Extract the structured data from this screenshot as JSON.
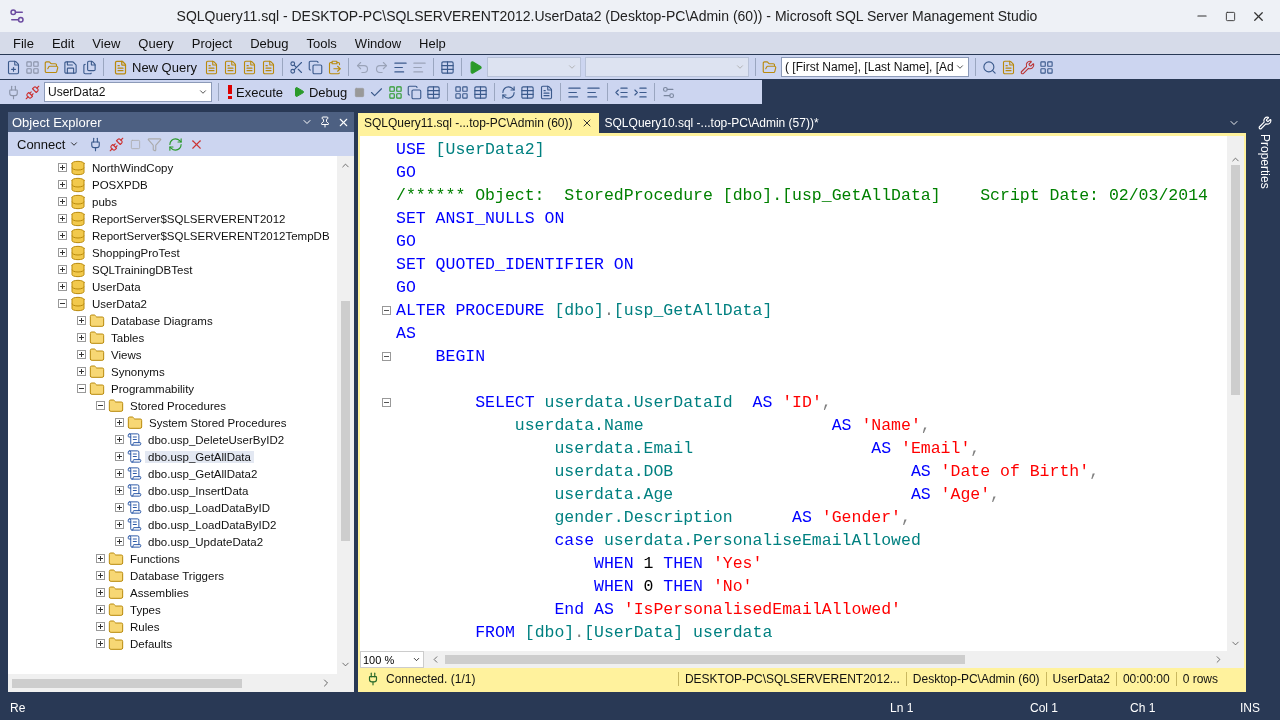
{
  "window": {
    "title": "SQLQuery11.sql - DESKTOP-PC\\SQLSERVERENT2012.UserData2 (Desktop-PC\\Admin (60)) - Microsoft SQL Server Management Studio"
  },
  "menu": [
    "File",
    "Edit",
    "View",
    "Query",
    "Project",
    "Debug",
    "Tools",
    "Window",
    "Help"
  ],
  "toolbar": {
    "new_query": "New Query",
    "database": "UserData2",
    "execute": "Execute",
    "debug": "Debug",
    "columns_combo": "( [First Name], [Last Name], [Ad"
  },
  "object_explorer": {
    "title": "Object Explorer",
    "connect": "Connect",
    "tree": [
      {
        "label": "NorthWindCopy",
        "kind": "db",
        "expanded": false,
        "selected": false
      },
      {
        "label": "POSXPDB",
        "kind": "db",
        "expanded": false,
        "selected": false
      },
      {
        "label": "pubs",
        "kind": "db",
        "expanded": false,
        "selected": false
      },
      {
        "label": "ReportServer$SQLSERVERENT2012",
        "kind": "db",
        "expanded": false,
        "selected": false
      },
      {
        "label": "ReportServer$SQLSERVERENT2012TempDB",
        "kind": "db",
        "expanded": false,
        "selected": false
      },
      {
        "label": "ShoppingProTest",
        "kind": "db",
        "expanded": false,
        "selected": false
      },
      {
        "label": "SQLTrainingDBTest",
        "kind": "db",
        "expanded": false,
        "selected": false
      },
      {
        "label": "UserData",
        "kind": "db",
        "expanded": false,
        "selected": false
      },
      {
        "label": "UserData2",
        "kind": "db",
        "expanded": true,
        "selected": false,
        "children": [
          {
            "label": "Database Diagrams",
            "kind": "folder",
            "expanded": false,
            "selected": false
          },
          {
            "label": "Tables",
            "kind": "folder",
            "expanded": false,
            "selected": false
          },
          {
            "label": "Views",
            "kind": "folder",
            "expanded": false,
            "selected": false
          },
          {
            "label": "Synonyms",
            "kind": "folder",
            "expanded": false,
            "selected": false
          },
          {
            "label": "Programmability",
            "kind": "folder",
            "expanded": true,
            "selected": false,
            "children": [
              {
                "label": "Stored Procedures",
                "kind": "folder",
                "expanded": true,
                "selected": false,
                "children": [
                  {
                    "label": "System Stored Procedures",
                    "kind": "folder",
                    "expanded": false,
                    "selected": false
                  },
                  {
                    "label": "dbo.usp_DeleteUserByID2",
                    "kind": "proc",
                    "expanded": false,
                    "selected": false
                  },
                  {
                    "label": "dbo.usp_GetAllData",
                    "kind": "proc",
                    "expanded": false,
                    "selected": true
                  },
                  {
                    "label": "dbo.usp_GetAllData2",
                    "kind": "proc",
                    "expanded": false,
                    "selected": false
                  },
                  {
                    "label": "dbo.usp_InsertData",
                    "kind": "proc",
                    "expanded": false,
                    "selected": false
                  },
                  {
                    "label": "dbo.usp_LoadDataByID",
                    "kind": "proc",
                    "expanded": false,
                    "selected": false
                  },
                  {
                    "label": "dbo.usp_LoadDataByID2",
                    "kind": "proc",
                    "expanded": false,
                    "selected": false
                  },
                  {
                    "label": "dbo.usp_UpdateData2",
                    "kind": "proc",
                    "expanded": false,
                    "selected": false
                  }
                ]
              },
              {
                "label": "Functions",
                "kind": "folder",
                "expanded": false,
                "selected": false
              },
              {
                "label": "Database Triggers",
                "kind": "folder",
                "expanded": false,
                "selected": false
              },
              {
                "label": "Assemblies",
                "kind": "folder",
                "expanded": false,
                "selected": false
              },
              {
                "label": "Types",
                "kind": "folder",
                "expanded": false,
                "selected": false
              },
              {
                "label": "Rules",
                "kind": "folder",
                "expanded": false,
                "selected": false
              },
              {
                "label": "Defaults",
                "kind": "folder",
                "expanded": false,
                "selected": false
              }
            ]
          }
        ]
      }
    ]
  },
  "editor": {
    "tabs": [
      {
        "label": "SQLQuery11.sql -...top-PC\\Admin (60))",
        "selected": true
      },
      {
        "label": "SQLQuery10.sql -...top-PC\\Admin (57))*",
        "selected": false
      }
    ],
    "lines": [
      {
        "fold": false,
        "tokens": [
          {
            "kind": "kw",
            "text": "USE "
          },
          {
            "kind": "id",
            "text": "[UserData2]"
          }
        ]
      },
      {
        "fold": false,
        "tokens": [
          {
            "kind": "kw",
            "text": "GO"
          }
        ]
      },
      {
        "fold": false,
        "tokens": [
          {
            "kind": "cm",
            "text": "/****** Object:  StoredProcedure [dbo].[usp_GetAllData]    Script Date: 02/03/2014"
          }
        ]
      },
      {
        "fold": false,
        "tokens": [
          {
            "kind": "kw",
            "text": "SET ANSI_NULLS ON"
          }
        ]
      },
      {
        "fold": false,
        "tokens": [
          {
            "kind": "kw",
            "text": "GO"
          }
        ]
      },
      {
        "fold": false,
        "tokens": [
          {
            "kind": "kw",
            "text": "SET QUOTED_IDENTIFIER ON"
          }
        ]
      },
      {
        "fold": false,
        "tokens": [
          {
            "kind": "kw",
            "text": "GO"
          }
        ]
      },
      {
        "fold": true,
        "tokens": [
          {
            "kind": "kw",
            "text": "ALTER PROCEDURE "
          },
          {
            "kind": "id",
            "text": "[dbo]"
          },
          {
            "kind": "op",
            "text": "."
          },
          {
            "kind": "id",
            "text": "[usp_GetAllData]"
          }
        ]
      },
      {
        "fold": false,
        "tokens": [
          {
            "kind": "kw",
            "text": "AS"
          }
        ]
      },
      {
        "fold": true,
        "tokens": [
          {
            "kind": "kw",
            "text": "    BEGIN"
          }
        ]
      },
      {
        "fold": false
      },
      {
        "fold": true,
        "tokens": [
          {
            "kind": "kw",
            "text": "        SELECT "
          },
          {
            "kind": "id",
            "text": "userdata.UserDataId"
          },
          {
            "kind": "kw",
            "text": "  AS "
          },
          {
            "kind": "str",
            "text": "'ID'"
          },
          {
            "kind": "op",
            "text": ","
          }
        ]
      },
      {
        "fold": false,
        "tokens": [
          {
            "kind": "id",
            "text": "            userdata.Name"
          },
          {
            "kind": "kw",
            "text": "                   AS "
          },
          {
            "kind": "str",
            "text": "'Name'"
          },
          {
            "kind": "op",
            "text": ","
          }
        ]
      },
      {
        "fold": false,
        "tokens": [
          {
            "kind": "id",
            "text": "                userdata.Email"
          },
          {
            "kind": "kw",
            "text": "                  AS "
          },
          {
            "kind": "str",
            "text": "'Email'"
          },
          {
            "kind": "op",
            "text": ","
          }
        ]
      },
      {
        "fold": false,
        "tokens": [
          {
            "kind": "id",
            "text": "                userdata.DOB"
          },
          {
            "kind": "kw",
            "text": "                        AS "
          },
          {
            "kind": "str",
            "text": "'Date of Birth'"
          },
          {
            "kind": "op",
            "text": ","
          }
        ]
      },
      {
        "fold": false,
        "tokens": [
          {
            "kind": "id",
            "text": "                userdata.Age"
          },
          {
            "kind": "kw",
            "text": "                        AS "
          },
          {
            "kind": "str",
            "text": "'Age'"
          },
          {
            "kind": "op",
            "text": ","
          }
        ]
      },
      {
        "fold": false,
        "tokens": [
          {
            "kind": "id",
            "text": "                gender.Description"
          },
          {
            "kind": "kw",
            "text": "      AS "
          },
          {
            "kind": "str",
            "text": "'Gender'"
          },
          {
            "kind": "op",
            "text": ","
          }
        ]
      },
      {
        "fold": false,
        "tokens": [
          {
            "kind": "kw",
            "text": "                case "
          },
          {
            "kind": "id",
            "text": "userdata.PersonaliseEmailAllowed"
          }
        ]
      },
      {
        "fold": false,
        "tokens": [
          {
            "kind": "kw",
            "text": "                    WHEN "
          },
          {
            "kind": "txt",
            "text": "1"
          },
          {
            "kind": "kw",
            "text": " THEN "
          },
          {
            "kind": "str",
            "text": "'Yes'"
          }
        ]
      },
      {
        "fold": false,
        "tokens": [
          {
            "kind": "kw",
            "text": "                    WHEN "
          },
          {
            "kind": "txt",
            "text": "0"
          },
          {
            "kind": "kw",
            "text": " THEN "
          },
          {
            "kind": "str",
            "text": "'No'"
          }
        ]
      },
      {
        "fold": false,
        "tokens": [
          {
            "kind": "kw",
            "text": "                End AS "
          },
          {
            "kind": "str",
            "text": "'IsPersonalisedEmailAllowed'"
          }
        ]
      },
      {
        "fold": false,
        "tokens": [
          {
            "kind": "kw",
            "text": "        FROM "
          },
          {
            "kind": "id",
            "text": "[dbo]"
          },
          {
            "kind": "op",
            "text": "."
          },
          {
            "kind": "id",
            "text": "[UserData] userdata"
          }
        ]
      }
    ],
    "zoom": "100 %",
    "query_status": {
      "connection": "Connected. (1/1)",
      "server": "DESKTOP-PC\\SQLSERVERENT2012...",
      "login": "Desktop-PC\\Admin (60)",
      "database": "UserData2",
      "elapsed": "00:00:00",
      "rows": "0 rows"
    },
    "properties_tab": "Properties"
  },
  "status_bar": {
    "message": "Re",
    "line": "Ln 1",
    "column": "Col 1",
    "char": "Ch 1",
    "mode": "INS"
  }
}
